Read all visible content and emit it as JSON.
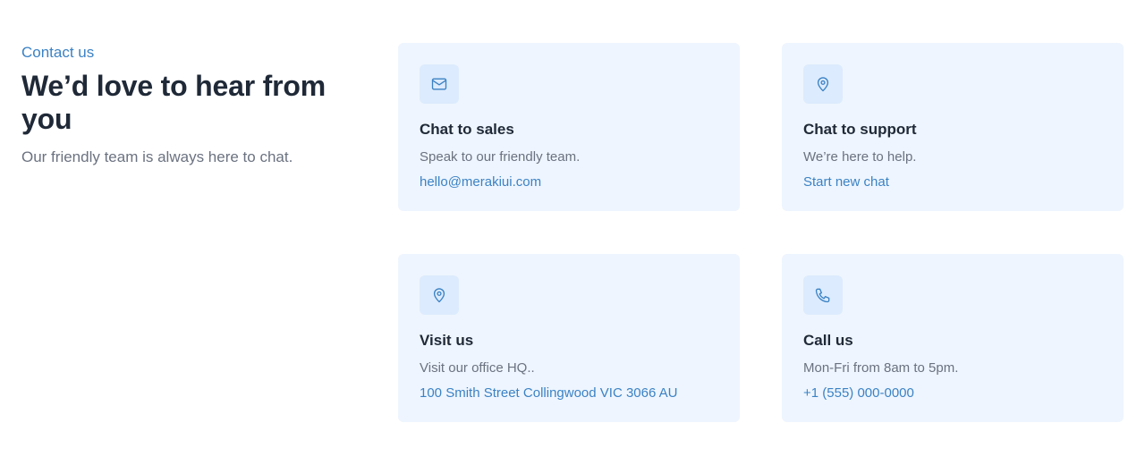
{
  "intro": {
    "eyebrow": "Contact us",
    "heading": "We’d love to hear from you",
    "subtext": "Our friendly team is always here to chat."
  },
  "cards": [
    {
      "icon": "mail-icon",
      "title": "Chat to sales",
      "description": "Speak to our friendly team.",
      "link": "hello@merakiui.com"
    },
    {
      "icon": "map-pin-icon",
      "title": "Chat to support",
      "description": "We’re here to help.",
      "link": "Start new chat"
    },
    {
      "icon": "map-pin-icon",
      "title": "Visit us",
      "description": "Visit our office HQ..",
      "link": "100 Smith Street Collingwood VIC 3066 AU"
    },
    {
      "icon": "phone-icon",
      "title": "Call us",
      "description": "Mon-Fri from 8am to 5pm.",
      "link": "+1 (555) 000-0000"
    }
  ],
  "colors": {
    "accent": "#3b82c4",
    "card_background": "#eef5fe",
    "icon_background": "#dcebfd",
    "heading": "#1f2937",
    "muted_text": "#6b7280"
  }
}
